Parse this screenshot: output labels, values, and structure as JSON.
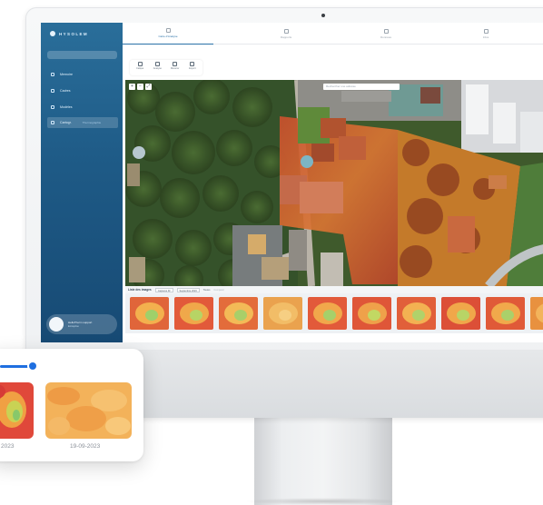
{
  "app": {
    "logo_text": "HYSOLEM"
  },
  "sidebar": {
    "search_placeholder": "",
    "items": [
      {
        "label": "Memoire",
        "icon": "home-icon"
      },
      {
        "label": "Cadres",
        "icon": "layers-icon"
      },
      {
        "label": "Modèles",
        "icon": "grid-icon"
      },
      {
        "label": "Cartogr.",
        "sub": "Thermographie",
        "icon": "map-icon",
        "active": true
      }
    ],
    "user": {
      "name": "HelloTherm support",
      "role": "Entreprise"
    }
  },
  "tabs": [
    {
      "label": "Carte d'Analyse",
      "icon": "map-icon",
      "active": true
    },
    {
      "label": "Rapports",
      "icon": "document-icon",
      "active": false
    },
    {
      "label": "Données",
      "icon": "chart-icon",
      "active": false
    },
    {
      "label": "Infos",
      "icon": "info-icon",
      "active": false
    }
  ],
  "toolbar": [
    {
      "label": "Calque",
      "icon": "layers-icon"
    },
    {
      "label": "Analyse",
      "icon": "chart-icon"
    },
    {
      "label": "Mesurer",
      "icon": "ruler-icon"
    },
    {
      "label": "Export",
      "icon": "download-icon"
    }
  ],
  "map": {
    "search_placeholder": "Rechercher une adresse",
    "controls": [
      "+",
      "−",
      "⤢"
    ]
  },
  "filmstrip": {
    "title": "Liste des images",
    "select_type": "Captures IR",
    "select_period": "Septembre 2023",
    "toggle_label": "Toutes",
    "link_label": "Comparer"
  },
  "popup": {
    "slider_value": 0.45,
    "items": [
      {
        "date": "2023"
      },
      {
        "date": "19-09-2023"
      }
    ]
  },
  "colors": {
    "sidebar_top": "#2a6e9a",
    "sidebar_bottom": "#174a74",
    "accent": "#2a72a8",
    "slider": "#1f6fe0"
  }
}
